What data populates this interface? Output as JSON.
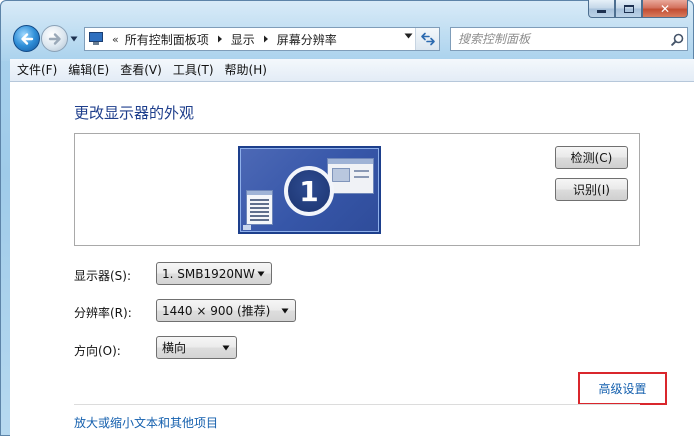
{
  "window": {
    "caption_buttons": {
      "minimize": "minimize",
      "maximize": "maximize",
      "close": "✕"
    }
  },
  "nav": {
    "back_icon": "back-arrow-icon",
    "forward_icon": "forward-arrow-icon",
    "history_icon": "chevron-down-icon"
  },
  "address": {
    "overflow": "«",
    "crumbs": [
      "所有控制面板项",
      "显示",
      "屏幕分辨率"
    ],
    "refresh_icon": "refresh-icon"
  },
  "search": {
    "placeholder": "搜索控制面板",
    "icon": "search-icon"
  },
  "menu": {
    "items": [
      "文件(F)",
      "编辑(E)",
      "查看(V)",
      "工具(T)",
      "帮助(H)"
    ]
  },
  "main": {
    "title": "更改显示器的外观",
    "monitor_number": "1",
    "detect_label": "检测(C)",
    "identify_label": "识别(I)",
    "display_label": "显示器(S):",
    "display_value": "1. SMB1920NW",
    "resolution_label": "分辨率(R):",
    "resolution_value": "1440 × 900 (推荐)",
    "orientation_label": "方向(O):",
    "orientation_value": "横向",
    "advanced_link": "高级设置",
    "text_size_link": "放大或缩小文本和其他项目"
  },
  "colors": {
    "link": "#1560ae",
    "title": "#1e3e8c",
    "highlight_border": "#d9262c"
  }
}
